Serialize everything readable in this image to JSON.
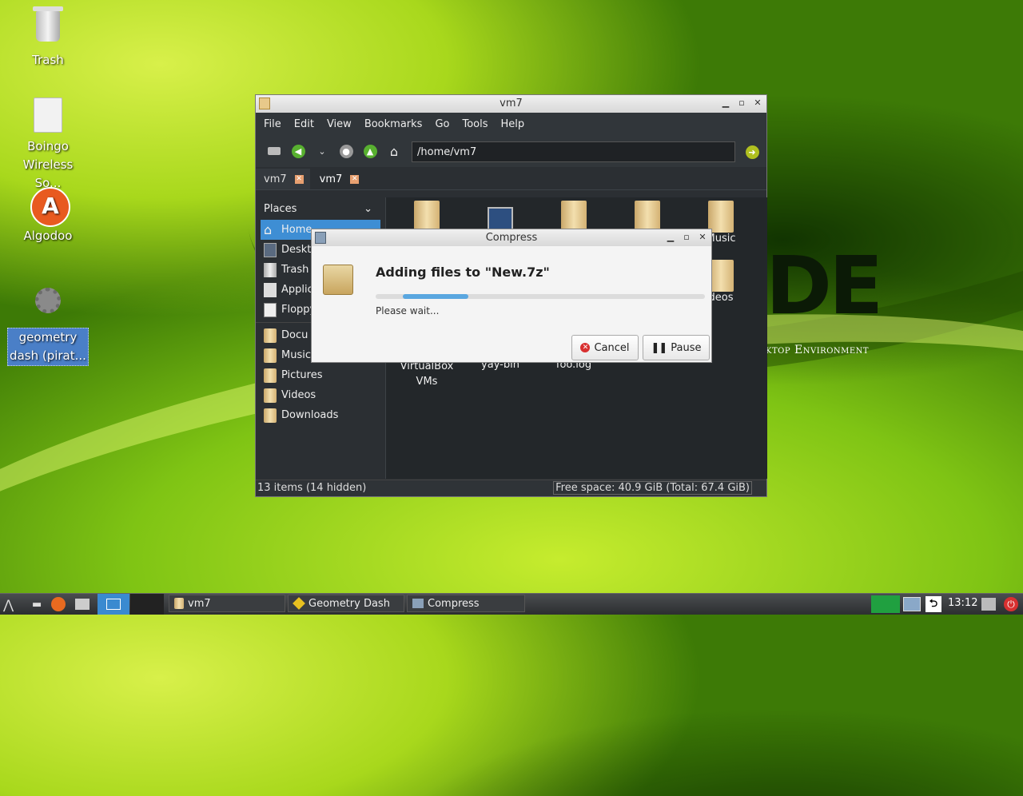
{
  "desktop": {
    "icons": [
      {
        "label": "Trash",
        "icon": "trash-icon"
      },
      {
        "label": "Boingo Wireless So...",
        "icon": "document-icon"
      },
      {
        "label": "Algodoo",
        "icon": "algodoo-icon"
      },
      {
        "label": "geometry dash (pirat...",
        "icon": "gear-icon"
      }
    ],
    "logo": "DE",
    "logo_sub": "ktop Environment"
  },
  "filemanager": {
    "title": "vm7",
    "menu": [
      "File",
      "Edit",
      "View",
      "Bookmarks",
      "Go",
      "Tools",
      "Help"
    ],
    "address": "/home/vm7",
    "tabs": [
      {
        "label": "vm7"
      },
      {
        "label": "vm7"
      }
    ],
    "places_label": "Places",
    "places": [
      "Home",
      "Deskt",
      "Trash",
      "Applic",
      "Floppy"
    ],
    "bookmarks": [
      "Docu",
      "Music",
      "Pictures",
      "Videos",
      "Downloads"
    ],
    "files": [
      {
        "label": ""
      },
      {
        "label": ""
      },
      {
        "label": ""
      },
      {
        "label": ""
      },
      {
        "label": "Music"
      },
      {
        "label": "deos"
      },
      {
        "label": "VirtualBox VMs"
      },
      {
        "label": "yay-bin"
      },
      {
        "label": "foo.log"
      }
    ],
    "status_left": "13 items (14 hidden)",
    "status_right": "Free space: 40.9 GiB (Total: 67.4 GiB)"
  },
  "compress": {
    "title": "Compress",
    "heading": "Adding files to \"New.7z\"",
    "progress_fraction": 0.2,
    "wait_text": "Please wait...",
    "cancel_label": "Cancel",
    "pause_label": "Pause"
  },
  "taskbar": {
    "tasks": [
      {
        "label": "vm7"
      },
      {
        "label": "Geometry Dash"
      },
      {
        "label": "Compress"
      }
    ],
    "clock": "13:12"
  }
}
